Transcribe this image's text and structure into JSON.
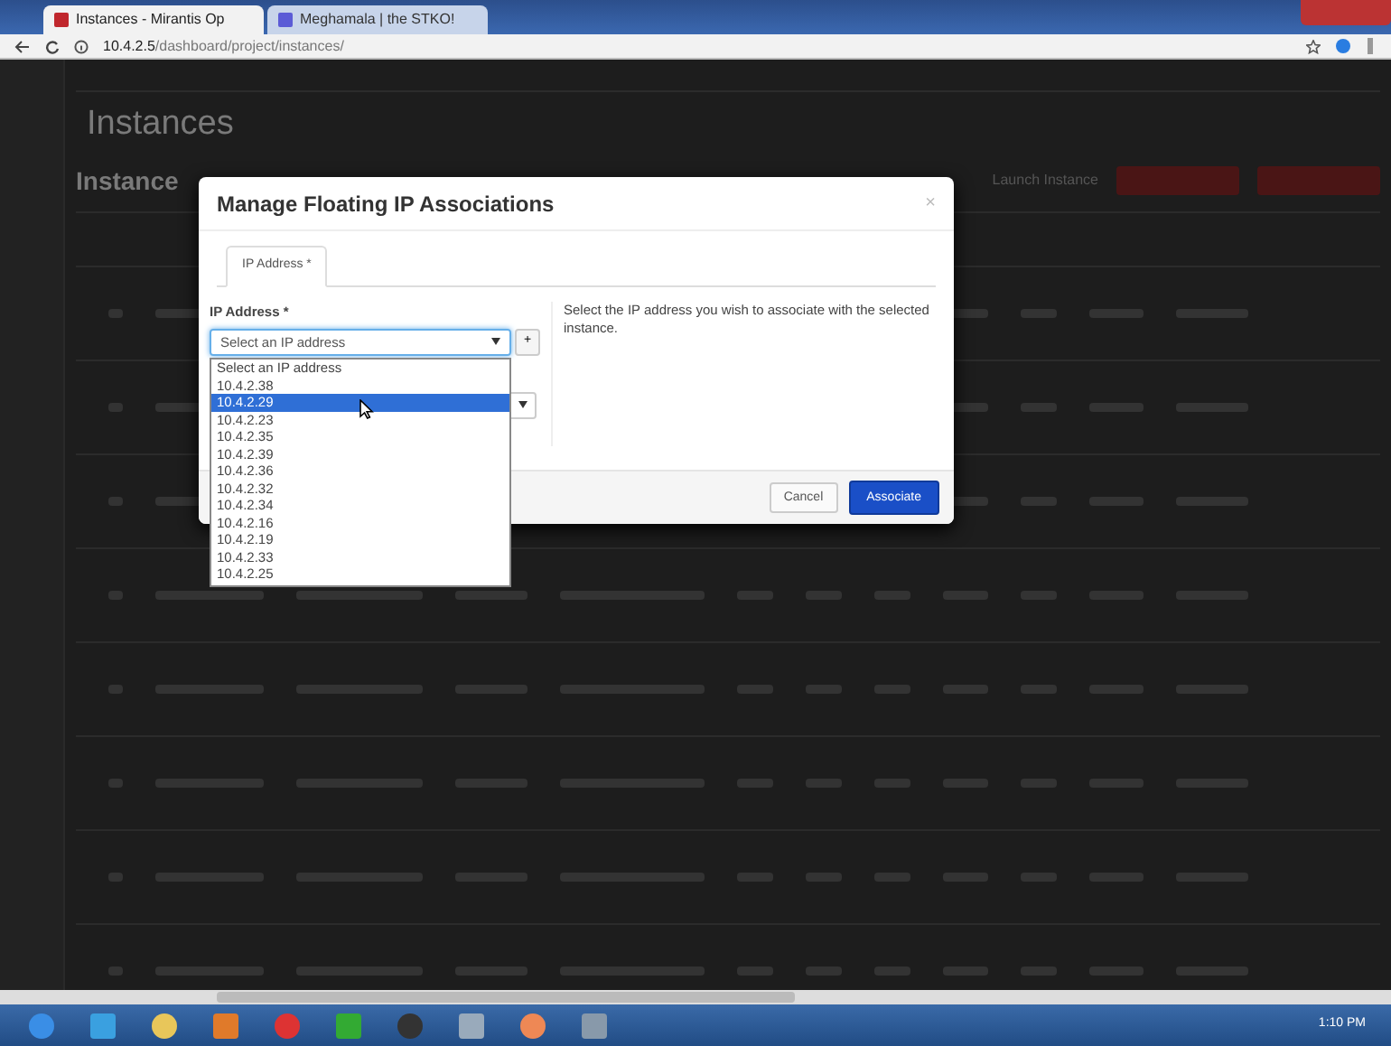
{
  "browser": {
    "tabs": [
      {
        "title": "Instances - Mirantis Op",
        "selected": true
      },
      {
        "title": "Meghamala | the STKO!",
        "selected": false
      }
    ],
    "url_host": "10.4.2.5",
    "url_path": "/dashboard/project/instances/"
  },
  "page": {
    "title": "Instances",
    "section_title": "Instance",
    "launch_button": "Launch Instance"
  },
  "modal": {
    "title": "Manage Floating IP Associations",
    "close": "×",
    "tabs": [
      {
        "label": "IP Address *",
        "selected": true
      }
    ],
    "field_label": "IP Address *",
    "select_value": "Select an IP address",
    "add_button": "+",
    "options": [
      {
        "label": "Select an IP address",
        "selected": false
      },
      {
        "label": "10.4.2.38",
        "selected": false
      },
      {
        "label": "10.4.2.29",
        "selected": true
      },
      {
        "label": "10.4.2.23",
        "selected": false
      },
      {
        "label": "10.4.2.35",
        "selected": false
      },
      {
        "label": "10.4.2.39",
        "selected": false
      },
      {
        "label": "10.4.2.36",
        "selected": false
      },
      {
        "label": "10.4.2.32",
        "selected": false
      },
      {
        "label": "10.4.2.34",
        "selected": false
      },
      {
        "label": "10.4.2.16",
        "selected": false
      },
      {
        "label": "10.4.2.19",
        "selected": false
      },
      {
        "label": "10.4.2.33",
        "selected": false
      },
      {
        "label": "10.4.2.25",
        "selected": false
      }
    ],
    "help": "Select the IP address you wish to associate with the selected instance.",
    "buttons": [
      {
        "label": "Cancel",
        "kind": "secondary"
      },
      {
        "label": "Associate",
        "kind": "primary"
      }
    ]
  },
  "taskbar": {
    "clock": "1:10 PM"
  }
}
